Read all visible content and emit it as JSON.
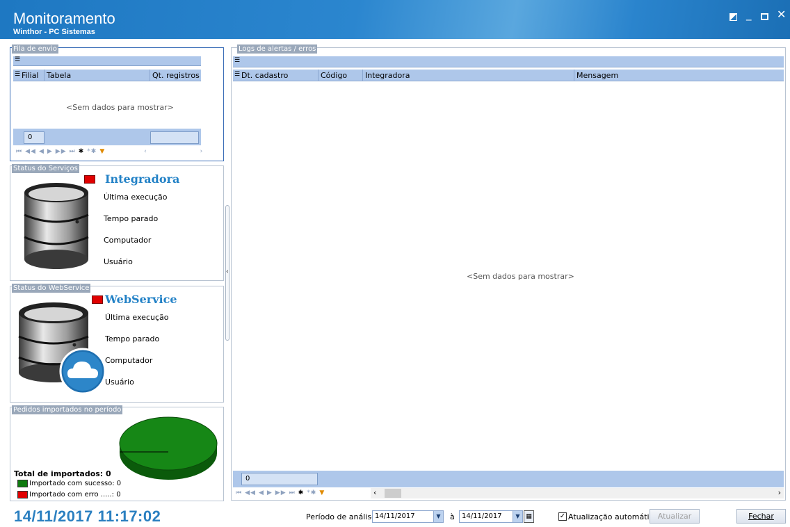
{
  "window": {
    "title": "Monitoramento",
    "subtitle": "Winthor - PC Sistemas"
  },
  "fila": {
    "group_label": "Fila de envio",
    "columns": [
      "Filial",
      "Tabela",
      "Qt. registros"
    ],
    "empty_text": "<Sem dados para mostrar>",
    "count": "0"
  },
  "servicos": {
    "group_label": "Status do Serviços",
    "name": "Integradora",
    "fields": [
      "Última execução",
      "Tempo parado",
      "Computador",
      "Usuário"
    ],
    "status_color": "#e00000"
  },
  "webservice": {
    "group_label": "Status do WebService",
    "name": "WebService",
    "fields": [
      "Última execução",
      "Tempo parado",
      "Computador",
      "Usuário"
    ],
    "status_color": "#e00000"
  },
  "pedidos": {
    "group_label": "Pedidos importados no período",
    "total_label": "Total de importados: 0",
    "legend": [
      {
        "label": "Importado com sucesso: 0",
        "color": "#0f7a0f"
      },
      {
        "label": "Importado com erro .....: 0",
        "color": "#e00000"
      }
    ],
    "chart_data": {
      "type": "pie",
      "values": [],
      "fill_color": "#168716"
    }
  },
  "logs": {
    "group_label": "Logs de alertas / erros",
    "columns": [
      "Dt. cadastro",
      "Código",
      "Integradora",
      "Mensagem"
    ],
    "empty_text": "<Sem dados para mostrar>",
    "count": "0"
  },
  "footer": {
    "clock": "14/11/2017  11:17:02",
    "periodo_label": "Período de análise:",
    "date_from": "14/11/2017",
    "a_label": "à",
    "date_to": "14/11/2017",
    "auto_update_label": "Atualização automática",
    "auto_update_checked": true,
    "atualizar_label": "Atualizar",
    "fechar_label": "Fechar"
  },
  "icons": {
    "nav": [
      "first-icon",
      "prev-page-icon",
      "prev-icon",
      "next-icon",
      "next-page-icon",
      "last-icon",
      "append-icon",
      "delete-icon",
      "filter-icon"
    ]
  }
}
